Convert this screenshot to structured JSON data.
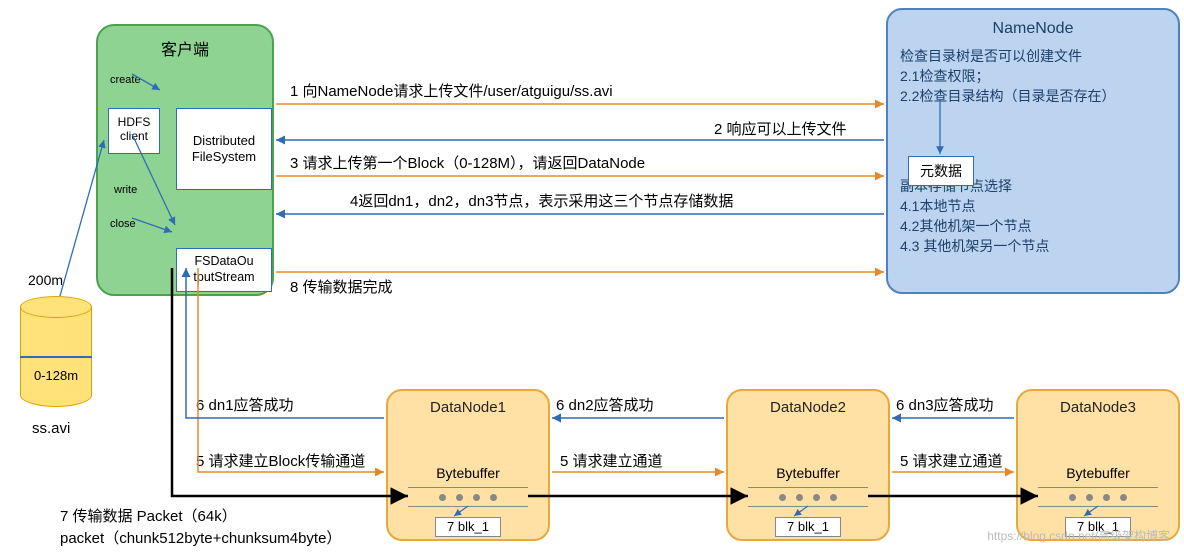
{
  "client": {
    "title": "客户端",
    "create": "create",
    "write": "write",
    "close": "close",
    "hdfs_client_l1": "HDFS",
    "hdfs_client_l2": "client",
    "dfs_l1": "Distributed",
    "dfs_l2": "FileSystem",
    "fsout_l1": "FSDataOu",
    "fsout_l2": "tputStream"
  },
  "namenode": {
    "title": "NameNode",
    "line1": "检查目录树是否可以创建文件",
    "line2": "2.1检查权限；",
    "line3": "2.2检查目录结构（目录是否存在）",
    "meta": "元数据",
    "rep_title": "副本存储节点选择",
    "rep1": "4.1本地节点",
    "rep2": "4.2其他机架一个节点",
    "rep3": "4.3 其他机架另一个节点"
  },
  "disk": {
    "size": "200m",
    "range": "0-128m",
    "file": "ss.avi"
  },
  "datanodes": {
    "d1": "DataNode1",
    "d2": "DataNode2",
    "d3": "DataNode3",
    "bytebuffer": "Bytebuffer",
    "blk": "7 blk_1"
  },
  "msgs": {
    "m1": "1 向NameNode请求上传文件/user/atguigu/ss.avi",
    "m2": "2 响应可以上传文件",
    "m3": "3 请求上传第一个Block（0-128M），请返回DataNode",
    "m4": "4返回dn1，dn2，dn3节点，表示采用这三个节点存储数据",
    "m5c": "5 请求建立Block传输通道",
    "m5": "5 请求建立通道",
    "m6a": "6 dn1应答成功",
    "m6b": "6 dn2应答成功",
    "m6c": "6 dn3应答成功",
    "m7": "7 传输数据  Packet（64k）",
    "m7b": "packet（chunk512byte+chunksum4byte）",
    "m8": "8 传输数据完成"
  },
  "watermark": "https://blog.csdn.net/高级架构博客"
}
